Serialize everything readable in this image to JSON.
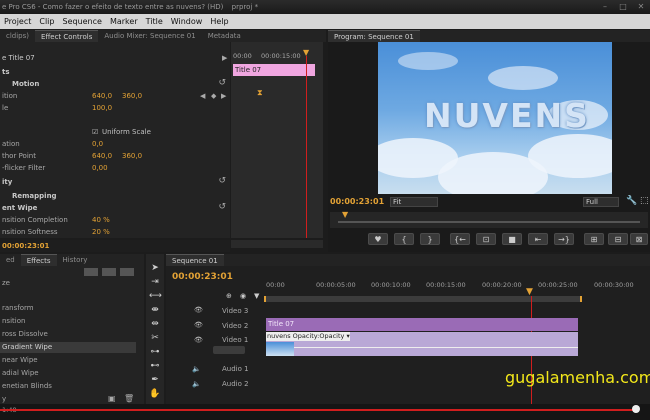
{
  "window": {
    "title": "e Pro CS6 - Como fazer o efeito de texto entre as nuvens? (HD)",
    "title_tail": "prproj *",
    "controls": [
      "–",
      "□",
      "✕"
    ]
  },
  "menu": [
    "Project",
    "Clip",
    "Sequence",
    "Marker",
    "Title",
    "Window",
    "Help"
  ],
  "effect_controls": {
    "tabs": [
      "cldips)",
      "Effect Controls",
      "Audio Mixer: Sequence 01",
      "Metadata"
    ],
    "clip_name": "e Title 07",
    "time_start": "00:00",
    "time_end": "00:00:15:00",
    "clip_bar_label": "Title 07",
    "rows": [
      {
        "label": "ts",
        "bold": true
      },
      {
        "label": "Motion",
        "bold": true
      },
      {
        "label": "ition",
        "v1": "640,0",
        "v2": "360,0"
      },
      {
        "label": "le",
        "v1": "100,0"
      },
      {
        "label": "",
        "v1": ""
      },
      {
        "label": "",
        "checkbox": "Uniform Scale"
      },
      {
        "label": "ation",
        "v1": "0,0"
      },
      {
        "label": "thor Point",
        "v1": "640,0",
        "v2": "360,0"
      },
      {
        "label": "-flicker Filter",
        "v1": "0,00"
      },
      {
        "label": "ity",
        "bold": true
      },
      {
        "label": "Remapping",
        "bold": true
      },
      {
        "label": "ent Wipe",
        "bold": true
      },
      {
        "label": "nsition Completion",
        "v1": "40 %"
      },
      {
        "label": "nsition Softness",
        "v1": "20 %"
      }
    ],
    "timecode": "00:00:23:01"
  },
  "program": {
    "tab": "Program: Sequence 01",
    "overlay_text": "NUVENS",
    "timecode": "00:00:23:01",
    "fit": "Fit",
    "quality": "Full",
    "buttons": [
      "♥",
      "{",
      "}",
      "{←",
      "⊡",
      "■",
      "⇤",
      "→}",
      "⊞",
      "⊟",
      "⊠"
    ]
  },
  "effects_panel": {
    "tabs": [
      "ed",
      "Effects",
      "History"
    ],
    "items": [
      "ze",
      "ransform",
      "nsition",
      "ross Dissolve",
      "Gradient Wipe",
      "near Wipe",
      "adial Wipe",
      "enetian Blinds",
      "y"
    ],
    "selected": "Gradient Wipe"
  },
  "timeline": {
    "tab": "Sequence 01",
    "timecode": "00:00:23:01",
    "ticks": [
      "00:00",
      "00:00:05:00",
      "00:00:10:00",
      "00:00:15:00",
      "00:00:20:00",
      "00:00:25:00",
      "00:00:30:00"
    ],
    "tracks": [
      {
        "name": "Video 3",
        "type": "video"
      },
      {
        "name": "Video 2",
        "type": "video"
      },
      {
        "name": "Video 1",
        "type": "video"
      },
      {
        "name": "Audio 1",
        "type": "audio"
      },
      {
        "name": "Audio 2",
        "type": "audio"
      }
    ],
    "clip_title": "Title 07",
    "clip_video": "nuvens Opacity:Opacity ▾"
  },
  "watermark": "gugalamenha.com",
  "bottom": {
    "time_label": "1:48"
  },
  "colors": {
    "accent_orange": "#e3a235",
    "clip_purple": "#9a6bb6",
    "playhead_red": "#d01e1e",
    "watermark_yellow": "#f3e81a"
  }
}
